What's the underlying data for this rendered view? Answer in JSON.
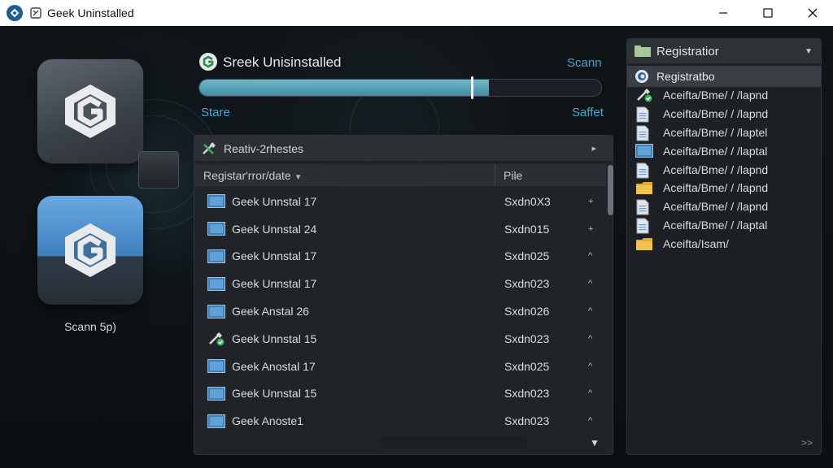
{
  "window": {
    "title": "Geek Uninstalled",
    "controls": [
      "minimize",
      "maximize",
      "close"
    ]
  },
  "left": {
    "tiles": [
      {
        "icon": "geek-logo-icon",
        "letter": "G"
      },
      {
        "icon": "geek-logo-icon",
        "letter": "G"
      }
    ],
    "caption": "Scann 5p)"
  },
  "header": {
    "title": "Sreek Unisinstalled",
    "scan_label": "Scann",
    "progress_percent": 72,
    "start_label": "Stare",
    "safe_label": "Saffet"
  },
  "table": {
    "panel_title": "Reativ-2rhestes",
    "columns": [
      "Registar'rror/date",
      "Pile"
    ],
    "rows": [
      {
        "name": "Geek Unnstal 17",
        "size": "Sxdn0X3",
        "marker": "+",
        "icon": "monitor-icon"
      },
      {
        "name": "Geek Unnstal 24",
        "size": "Sxdn015",
        "marker": "+",
        "icon": "monitor-icon"
      },
      {
        "name": "Geek Unnstal 17",
        "size": "Sxdn025",
        "marker": "^",
        "icon": "monitor-icon"
      },
      {
        "name": "Geek Unnstal 17",
        "size": "Sxdn023",
        "marker": "^",
        "icon": "monitor-icon"
      },
      {
        "name": "Geek Anstal 26",
        "size": "Sxdn026",
        "marker": "^",
        "icon": "monitor-icon"
      },
      {
        "name": "Geek Unnstal 15",
        "size": "Sxdn023",
        "marker": "^",
        "icon": "tools-icon"
      },
      {
        "name": "Geek Anostal 17",
        "size": "Sxdn025",
        "marker": "^",
        "icon": "monitor-icon"
      },
      {
        "name": "Geek Unnstal 15",
        "size": "Sxdn023",
        "marker": "^",
        "icon": "monitor-icon"
      },
      {
        "name": "Geek Anoste1",
        "size": "Sxdn023",
        "marker": "^",
        "icon": "monitor-icon"
      }
    ]
  },
  "registry": {
    "title": "Registratior",
    "selected": "Registratbo",
    "items": [
      {
        "text": "Aceifta/Bme/ / /lapnd",
        "icon": "tools-icon"
      },
      {
        "text": "Aceifta/Bme/ / /lapnd",
        "icon": "file-icon"
      },
      {
        "text": "Aceifta/Bme/ / /laptel",
        "icon": "file-icon"
      },
      {
        "text": "Aceifta/Bme/ / /laptal",
        "icon": "monitor-icon"
      },
      {
        "text": "Aceifta/Bme/ / /lapnd",
        "icon": "file-icon"
      },
      {
        "text": "Aceifta/Bme/ / /lapnd",
        "icon": "folder-icon"
      },
      {
        "text": "Aceifta/Bme/ / /lapnd",
        "icon": "file-icon"
      },
      {
        "text": "Aceifta/Bme/ / /laptal",
        "icon": "file-icon"
      },
      {
        "text": "Aceifta/Isam/",
        "icon": "folder-icon"
      }
    ],
    "footer_glyph": ">>"
  },
  "colors": {
    "accent": "#4aa6c9",
    "progress": "#4f9fb3",
    "titlebar": "#ffffff",
    "background": "#0d1114"
  }
}
